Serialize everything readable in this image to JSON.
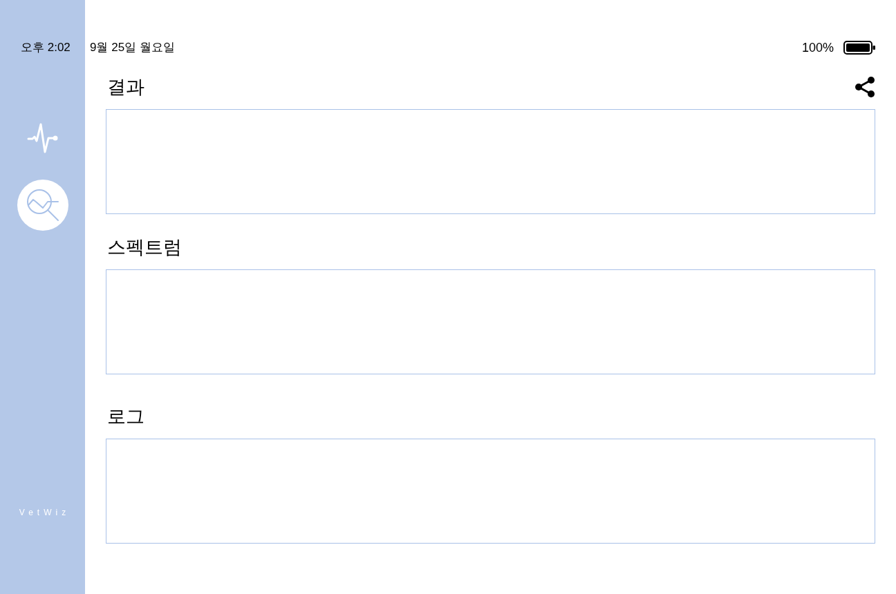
{
  "status_bar": {
    "time": "오후 2:02",
    "date": "9월 25일 월요일",
    "battery": "100%"
  },
  "sidebar": {
    "items": [
      {
        "kind": "waveform",
        "selected": false
      },
      {
        "kind": "chart-search",
        "selected": true
      }
    ],
    "logo": "VetWiz"
  },
  "sections": [
    {
      "title": "결과",
      "share": true
    },
    {
      "title": "스펙트럼",
      "share": false
    },
    {
      "title": "로그",
      "share": false
    }
  ]
}
